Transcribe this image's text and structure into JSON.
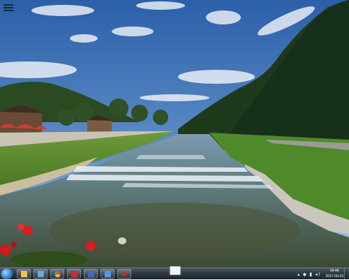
{
  "desktop": {
    "menu_icon": "hamburger-menu-icon"
  },
  "taskbar": {
    "start_icon": "windows-orb-icon",
    "pinned": [
      {
        "name": "explorer-icon",
        "color": "#f0c24a"
      },
      {
        "name": "documents-icon",
        "color": "#6aa7e0"
      },
      {
        "name": "chrome-icon",
        "color": "#e34a3c"
      },
      {
        "name": "acrobat-icon",
        "color": "#d12b2b"
      },
      {
        "name": "save-icon",
        "color": "#3b6fc0"
      },
      {
        "name": "photo-viewer-icon",
        "color": "#4c9be8"
      },
      {
        "name": "maple-leaf-icon",
        "color": "#d42323"
      }
    ],
    "clock": {
      "time": "09:48",
      "date": "2017-09-23"
    }
  }
}
